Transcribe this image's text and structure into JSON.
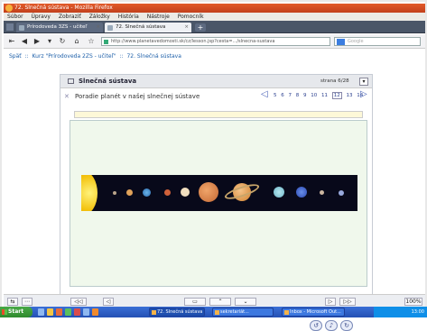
{
  "window": {
    "title": "72. Slnečná sústava - Mozilla Firefox"
  },
  "menu": [
    "Súbor",
    "Úpravy",
    "Zobraziť",
    "Záložky",
    "História",
    "Nástroje",
    "Pomocník"
  ],
  "tabs": [
    {
      "label": "Prírodoveda 3ZS - učiteľ"
    },
    {
      "label": "72. Slnečná sústava"
    }
  ],
  "url": "http://www.planetavedomosti.sk/cz/lesson.jsp?cesta=.../slnecna-sustava",
  "search_placeholder": "Google",
  "breadcrumb": {
    "home": "Späť",
    "sep1": "::",
    "course": "Kurz \"Prírodoveda 2ZS - učiteľ\"",
    "sep2": "::",
    "current": "72. Slnečná sústava"
  },
  "panel": {
    "title": "Slnečná sústava",
    "page_label": "strana 6/28",
    "subtitle": "Poradie planét v našej slnečnej sústave",
    "pages": [
      "5",
      "6",
      "7",
      "8",
      "9",
      "10",
      "11",
      "12",
      "13",
      "14"
    ],
    "current_page": "12"
  },
  "taskbar": {
    "start": "Start",
    "tasks": [
      "72. Slnečná sústava",
      "sekretariát...",
      "Inbox - Microsoft Out..."
    ],
    "clock": "13:00"
  },
  "status": {
    "zoom": "100%"
  }
}
